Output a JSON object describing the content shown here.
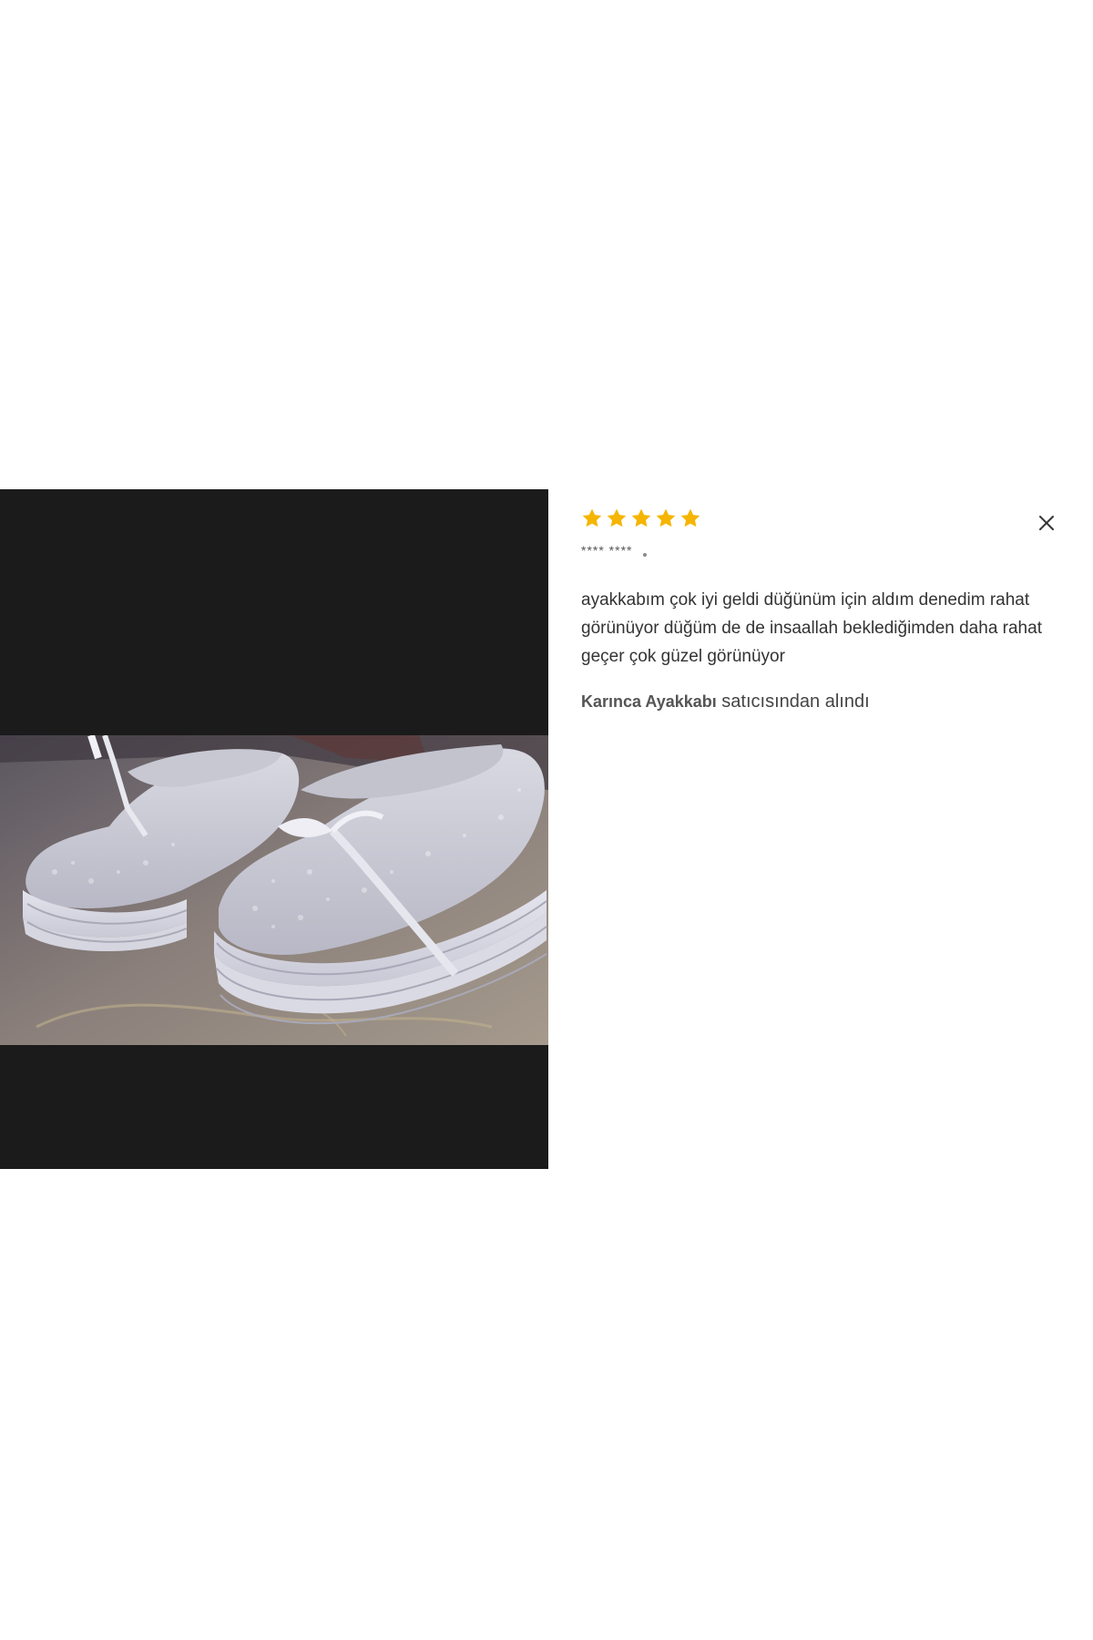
{
  "review": {
    "rating": 5,
    "max_rating": 5,
    "star_color": "#f5b500",
    "reviewer_name": "**** ****",
    "text": "ayakkabım çok iyi geldi düğünüm için aldım denedim rahat görünüyor düğüm de de insaallah beklediğimden daha rahat geçer çok güzel görünüyor",
    "seller_name": "Karınca Ayakkabı",
    "seller_suffix": " satıcısından alındı"
  },
  "icons": {
    "close": "close-icon",
    "star": "star-icon"
  },
  "colors": {
    "media_background": "#1b1b1b",
    "page_background": "#ffffff",
    "text": "#333333"
  }
}
